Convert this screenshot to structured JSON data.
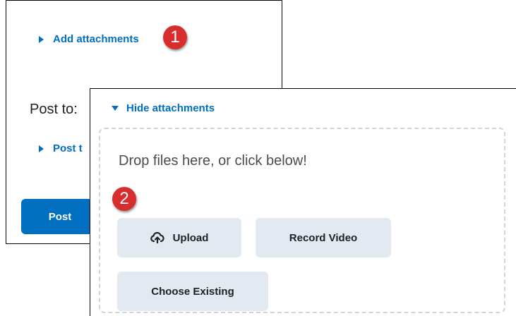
{
  "back_panel": {
    "add_attachments_label": "Add attachments",
    "post_to_label": "Post to:",
    "post_topic_label": "Post t",
    "post_button_label": "Post"
  },
  "front_panel": {
    "hide_attachments_label": "Hide attachments",
    "drop_text": "Drop files here, or click below!",
    "upload_label": "Upload",
    "record_video_label": "Record Video",
    "choose_existing_label": "Choose Existing"
  },
  "step_badges": [
    "1",
    "2"
  ],
  "colors": {
    "link": "#006fbf",
    "primary_button": "#006fbf",
    "secondary_button": "#e3e9f1",
    "badge": "#d72d2d",
    "dropzone_border": "#cdd5dc"
  },
  "icons": {
    "expand": "triangle-right-icon",
    "collapse": "triangle-down-icon",
    "upload": "cloud-upload-icon"
  }
}
